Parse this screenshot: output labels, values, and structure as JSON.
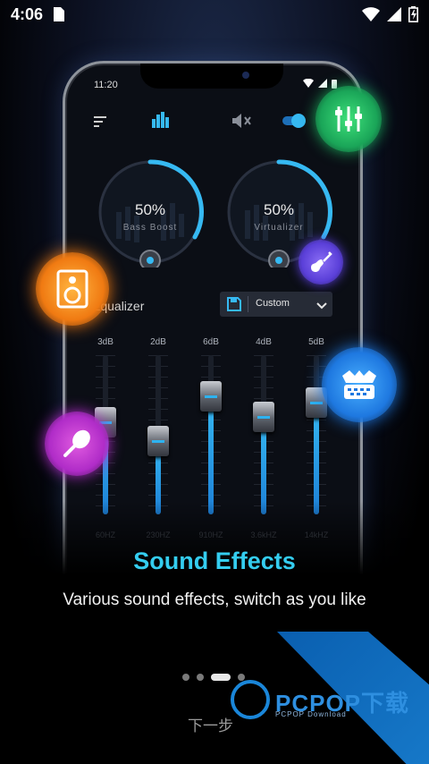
{
  "status_bar": {
    "time": "4:06"
  },
  "phone": {
    "time": "11:20",
    "knobs": [
      {
        "value": "50%",
        "label": "Bass Boost"
      },
      {
        "value": "50%",
        "label": "Virtualizer"
      }
    ],
    "equalizer_label": "Equalizer",
    "preset": "Custom",
    "bands": [
      {
        "db": "3dB",
        "hz": "60HZ",
        "level": 0.58
      },
      {
        "db": "2dB",
        "hz": "230HZ",
        "level": 0.46
      },
      {
        "db": "6dB",
        "hz": "910HZ",
        "level": 0.74
      },
      {
        "db": "4dB",
        "hz": "3.6kHZ",
        "level": 0.61
      },
      {
        "db": "5dB",
        "hz": "14kHZ",
        "level": 0.7
      }
    ]
  },
  "onboarding": {
    "title": "Sound Effects",
    "subtitle": "Various sound effects, switch as you like",
    "next_label": "下一步",
    "page_index": 3,
    "page_count": 4
  },
  "watermark": {
    "brand": "PCPOP下载",
    "sub": "PCPOP Download"
  },
  "colors": {
    "accent": "#34cdf0",
    "eq_fill": "#2db2f0"
  },
  "icons": [
    "equalizer-icon",
    "speaker-icon",
    "guitar-icon",
    "maracas-icon",
    "accordion-icon"
  ]
}
